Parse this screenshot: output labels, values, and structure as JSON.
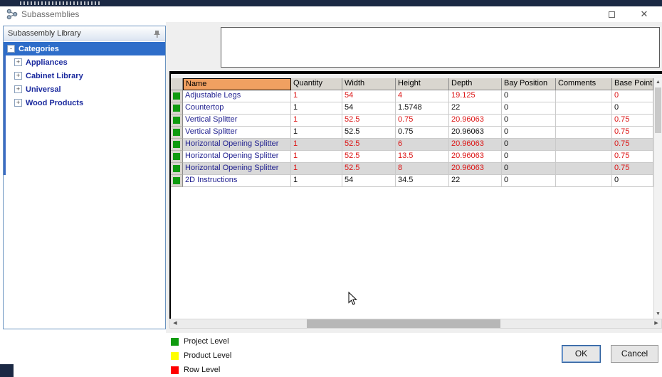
{
  "window": {
    "title": "Subassemblies"
  },
  "titlebar_buttons": {
    "maximize": "maximize",
    "close": "✕"
  },
  "sidebar": {
    "header": "Subassembly Library",
    "tree": [
      {
        "label": "Categories",
        "expander": "-",
        "level": 0,
        "selected": true
      },
      {
        "label": "Appliances",
        "expander": "+",
        "level": 1,
        "selected": false
      },
      {
        "label": "Cabinet Library",
        "expander": "+",
        "level": 1,
        "selected": false
      },
      {
        "label": "Universal",
        "expander": "+",
        "level": 1,
        "selected": false
      },
      {
        "label": "Wood Products",
        "expander": "+",
        "level": 1,
        "selected": false
      }
    ]
  },
  "grid": {
    "columns": [
      "Name",
      "Quantity",
      "Width",
      "Height",
      "Depth",
      "Bay Position",
      "Comments",
      "Base PointX"
    ],
    "rows": [
      {
        "bg": "white",
        "indicator": "green",
        "cells": [
          {
            "v": "Adjustable Legs",
            "c": "navy"
          },
          {
            "v": "1",
            "c": "red"
          },
          {
            "v": "54",
            "c": "red"
          },
          {
            "v": "4",
            "c": "red"
          },
          {
            "v": "19.125",
            "c": "red"
          },
          {
            "v": "0",
            "c": "k"
          },
          {
            "v": "",
            "c": "k"
          },
          {
            "v": "0",
            "c": "red"
          }
        ]
      },
      {
        "bg": "white",
        "indicator": "green",
        "cells": [
          {
            "v": "Countertop",
            "c": "navy"
          },
          {
            "v": "1",
            "c": "k"
          },
          {
            "v": "54",
            "c": "k"
          },
          {
            "v": "1.5748",
            "c": "k"
          },
          {
            "v": "22",
            "c": "k"
          },
          {
            "v": "0",
            "c": "k"
          },
          {
            "v": "",
            "c": "k"
          },
          {
            "v": "0",
            "c": "k"
          }
        ]
      },
      {
        "bg": "white",
        "indicator": "green",
        "cells": [
          {
            "v": "Vertical Splitter",
            "c": "navy"
          },
          {
            "v": "1",
            "c": "red"
          },
          {
            "v": "52.5",
            "c": "red"
          },
          {
            "v": "0.75",
            "c": "red"
          },
          {
            "v": "20.96063",
            "c": "red"
          },
          {
            "v": "0",
            "c": "k"
          },
          {
            "v": "",
            "c": "k"
          },
          {
            "v": "0.75",
            "c": "red"
          }
        ]
      },
      {
        "bg": "white",
        "indicator": "green",
        "cells": [
          {
            "v": "Vertical Splitter",
            "c": "navy"
          },
          {
            "v": "1",
            "c": "k"
          },
          {
            "v": "52.5",
            "c": "k"
          },
          {
            "v": "0.75",
            "c": "k"
          },
          {
            "v": "20.96063",
            "c": "k"
          },
          {
            "v": "0",
            "c": "k"
          },
          {
            "v": "",
            "c": "k"
          },
          {
            "v": "0.75",
            "c": "red"
          }
        ]
      },
      {
        "bg": "gray",
        "indicator": "green",
        "cells": [
          {
            "v": "Horizontal Opening Splitter",
            "c": "navy"
          },
          {
            "v": "1",
            "c": "red"
          },
          {
            "v": "52.5",
            "c": "red"
          },
          {
            "v": "6",
            "c": "red"
          },
          {
            "v": "20.96063",
            "c": "red"
          },
          {
            "v": "0",
            "c": "k"
          },
          {
            "v": "",
            "c": "k"
          },
          {
            "v": "0.75",
            "c": "red"
          }
        ]
      },
      {
        "bg": "white",
        "indicator": "green",
        "cells": [
          {
            "v": "Horizontal Opening Splitter",
            "c": "navy"
          },
          {
            "v": "1",
            "c": "red"
          },
          {
            "v": "52.5",
            "c": "red"
          },
          {
            "v": "13.5",
            "c": "red"
          },
          {
            "v": "20.96063",
            "c": "red"
          },
          {
            "v": "0",
            "c": "k"
          },
          {
            "v": "",
            "c": "k"
          },
          {
            "v": "0.75",
            "c": "red"
          }
        ]
      },
      {
        "bg": "gray",
        "indicator": "green",
        "cells": [
          {
            "v": "Horizontal Opening Splitter",
            "c": "navy"
          },
          {
            "v": "1",
            "c": "red"
          },
          {
            "v": "52.5",
            "c": "red"
          },
          {
            "v": "8",
            "c": "red"
          },
          {
            "v": "20.96063",
            "c": "red"
          },
          {
            "v": "0",
            "c": "k"
          },
          {
            "v": "",
            "c": "k"
          },
          {
            "v": "0.75",
            "c": "red"
          }
        ]
      },
      {
        "bg": "white",
        "indicator": "green",
        "cells": [
          {
            "v": "2D Instructions",
            "c": "navy"
          },
          {
            "v": "1",
            "c": "k"
          },
          {
            "v": "54",
            "c": "k"
          },
          {
            "v": "34.5",
            "c": "k"
          },
          {
            "v": "22",
            "c": "k"
          },
          {
            "v": "0",
            "c": "k"
          },
          {
            "v": "",
            "c": "k"
          },
          {
            "v": "0",
            "c": "k"
          }
        ]
      }
    ]
  },
  "legend": [
    {
      "color": "#0f9b0f",
      "label": "Project Level"
    },
    {
      "color": "#ffff00",
      "label": "Product Level"
    },
    {
      "color": "#ff0000",
      "label": "Row Level"
    }
  ],
  "buttons": {
    "ok": "OK",
    "cancel": "Cancel"
  },
  "colors": {
    "selection_blue": "#2e6dc9",
    "name_header_orange": "#f0a061",
    "value_red": "#dc1414",
    "name_navy": "#1f1f8f",
    "indicator_green": "#0f9b0f",
    "top_strip_navy": "#1b2944"
  }
}
